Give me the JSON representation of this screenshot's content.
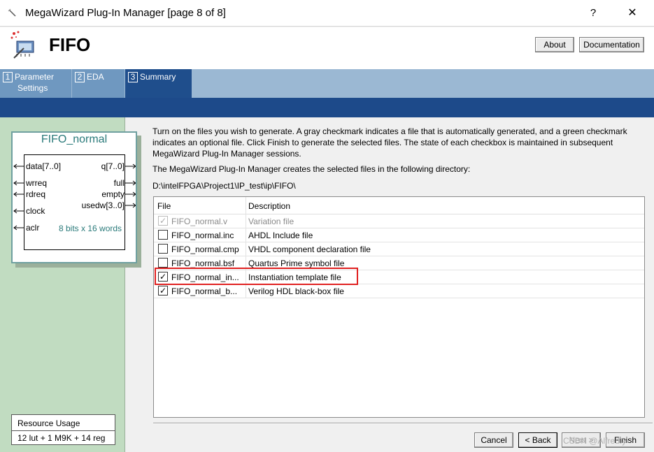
{
  "window": {
    "title": "MegaWizard Plug-In Manager [page 8 of 8]",
    "help": "?",
    "close": "✕"
  },
  "header": {
    "heading": "FIFO",
    "about_label": "About",
    "documentation_label": "Documentation"
  },
  "tabs": [
    {
      "num": "1",
      "label_line1": "Parameter",
      "label_line2": "Settings"
    },
    {
      "num": "2",
      "label_line1": "EDA",
      "label_line2": ""
    },
    {
      "num": "3",
      "label_line1": "Summary",
      "label_line2": ""
    }
  ],
  "symbol": {
    "title": "FIFO_normal",
    "ports_left": [
      "data[7..0]",
      "wrreq",
      "rdreq",
      "clock",
      "aclr"
    ],
    "ports_right": [
      "q[7..0]",
      "full",
      "empty",
      "usedw[3..0]"
    ],
    "note": "8 bits x 16 words"
  },
  "resource": {
    "label": "Resource Usage",
    "value": "12 lut + 1 M9K + 14 reg"
  },
  "content": {
    "instructions": "Turn on the files you wish to generate. A gray checkmark indicates a file that is automatically generated, and a green checkmark indicates an optional file. Click Finish to generate the selected files. The state of each checkbox is maintained in subsequent MegaWizard Plug-In Manager sessions.",
    "directory_note": "The MegaWizard Plug-In Manager creates the selected files in the following directory:",
    "directory": "D:\\intelFPGA\\Project1\\IP_test\\ip\\FIFO\\"
  },
  "filelist": {
    "col_file": "File",
    "col_desc": "Description",
    "rows": [
      {
        "name": "FIFO_normal.v",
        "desc": "Variation file",
        "check": "✓"
      },
      {
        "name": "FIFO_normal.inc",
        "desc": "AHDL Include file",
        "check": ""
      },
      {
        "name": "FIFO_normal.cmp",
        "desc": "VHDL component declaration file",
        "check": ""
      },
      {
        "name": "FIFO_normal.bsf",
        "desc": "Quartus Prime symbol file",
        "check": ""
      },
      {
        "name": "FIFO_normal_in...",
        "desc": "Instantiation template file",
        "check": "✓"
      },
      {
        "name": "FIFO_normal_b...",
        "desc": "Verilog HDL black-box file",
        "check": "✓"
      }
    ]
  },
  "footer": {
    "cancel_label": "Cancel",
    "back_label": "< Back",
    "next_label": "Next >",
    "finish_label": "Finish"
  },
  "watermark": "CSDN @Alfred.y"
}
